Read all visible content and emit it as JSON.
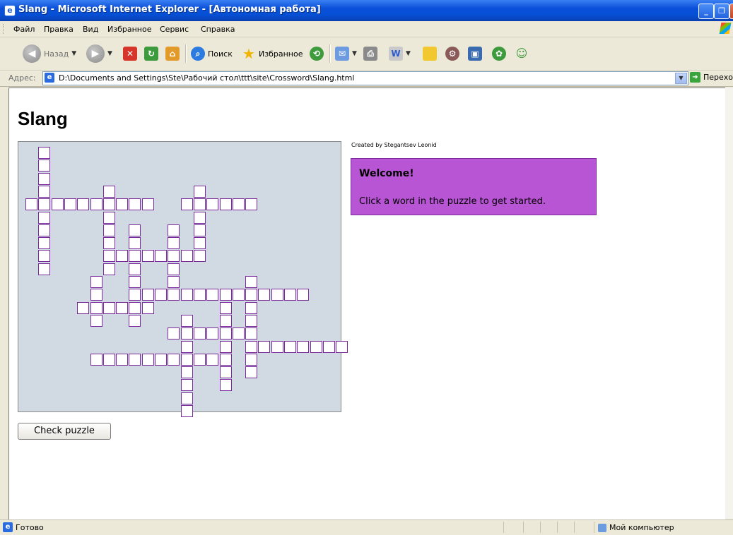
{
  "window": {
    "title": "Slang - Microsoft Internet Explorer - [Автономная работа]",
    "min_label": "_",
    "max_label": "❐",
    "close_label": "✕"
  },
  "menu": {
    "items": [
      "Файл",
      "Правка",
      "Вид",
      "Избранное",
      "Сервис",
      "Справка"
    ]
  },
  "toolbar": {
    "back_label": "Назад",
    "search_label": "Поиск",
    "favorites_label": "Избранное"
  },
  "address": {
    "label": "Адрес:",
    "url": "D:\\Documents and Settings\\Ste\\Рабочий стол\\ttt\\site\\Crossword\\Slang.html",
    "go_label": "Перехо"
  },
  "page": {
    "title": "Slang",
    "credit": "Created by Stegantsev Leonid",
    "clue_title": "Welcome!",
    "clue_text": "Click a word in the puzzle to get started.",
    "check_button": "Check puzzle"
  },
  "colors": {
    "clue_bg": "#b855d4",
    "cell_border": "#7a2a9a",
    "puzzle_bg": "#d1dae2"
  },
  "status": {
    "text": "Готово",
    "zone": "Мой компьютер"
  }
}
